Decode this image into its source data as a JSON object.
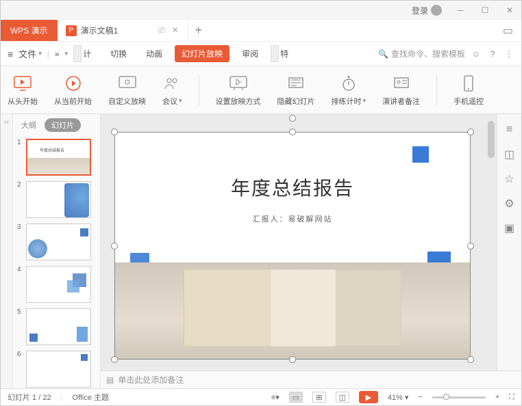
{
  "titlebar": {
    "login": "登录"
  },
  "tabs": {
    "appName": "WPS 演示",
    "docName": "演示文稿1",
    "docBadge": "P"
  },
  "menu": {
    "file": "文件",
    "more": "»",
    "items": {
      "design": "计",
      "transition": "切换",
      "animation": "动画",
      "slideshow": "幻灯片放映",
      "review": "审阅",
      "cut2": "特"
    },
    "searchPlaceholder": "查找命令、搜索模板"
  },
  "ribbon": {
    "fromStart": "从头开始",
    "fromCurrent": "从当前开始",
    "custom": "自定义放映",
    "meeting": "会议",
    "setup": "设置放映方式",
    "hide": "隐藏幻灯片",
    "rehearse": "排练计时",
    "speaker": "演讲者备注",
    "phone": "手机遥控"
  },
  "panel": {
    "outline": "大纲",
    "slides": "幻灯片"
  },
  "thumbs": [
    "1",
    "2",
    "3",
    "4",
    "5",
    "6"
  ],
  "slide": {
    "title": "年度总结报告",
    "subtitle": "汇报人：易破解网站"
  },
  "notes": {
    "placeholder": "单击此处添加备注"
  },
  "status": {
    "slideNum": "幻灯片 1 / 22",
    "theme": "Office 主题",
    "zoom": "41%"
  }
}
